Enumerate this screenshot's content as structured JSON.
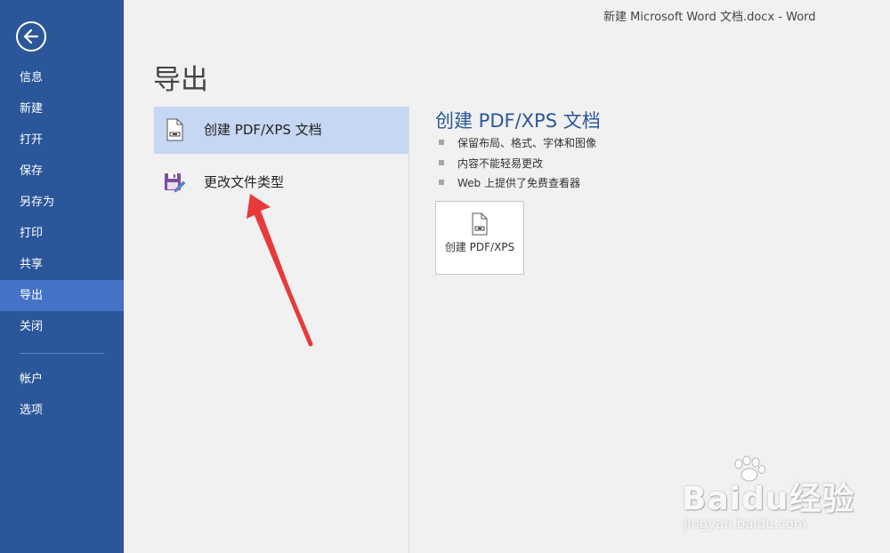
{
  "window": {
    "title": "新建 Microsoft Word 文档.docx - Word"
  },
  "sidebar": {
    "back_icon": "back-arrow-icon",
    "items": [
      {
        "label": "信息"
      },
      {
        "label": "新建"
      },
      {
        "label": "打开"
      },
      {
        "label": "保存"
      },
      {
        "label": "另存为"
      },
      {
        "label": "打印"
      },
      {
        "label": "共享"
      },
      {
        "label": "导出",
        "active": true
      },
      {
        "label": "关闭"
      }
    ],
    "bottom_items": [
      {
        "label": "帐户"
      },
      {
        "label": "选项"
      }
    ],
    "colors": {
      "background": "#2b579a",
      "active": "#4472c4"
    }
  },
  "main": {
    "title": "导出",
    "options": [
      {
        "label": "创建 PDF/XPS 文档",
        "icon": "pdf-document-icon",
        "selected": true
      },
      {
        "label": "更改文件类型",
        "icon": "change-file-type-icon",
        "selected": false
      }
    ]
  },
  "detail": {
    "title": "创建 PDF/XPS 文档",
    "bullets": [
      "保留布局、格式、字体和图像",
      "内容不能轻易更改",
      "Web 上提供了免费查看器"
    ],
    "button_label": "创建 PDF/XPS",
    "accent_color": "#2b579a"
  },
  "watermark": {
    "logo": "Baidu经验",
    "url": "jingyan.baidu.com"
  }
}
